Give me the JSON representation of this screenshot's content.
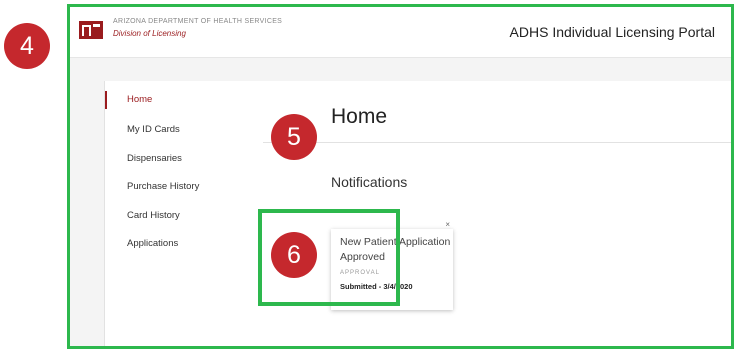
{
  "header": {
    "agency_name": "ARIZONA DEPARTMENT OF HEALTH SERVICES",
    "division": "Division of Licensing",
    "portal_title": "ADHS Individual Licensing Portal"
  },
  "sidebar": {
    "items": [
      {
        "label": "Home",
        "active": true
      },
      {
        "label": "My ID Cards"
      },
      {
        "label": "Dispensaries"
      },
      {
        "label": "Purchase History"
      },
      {
        "label": "Card History"
      },
      {
        "label": "Applications"
      }
    ]
  },
  "main": {
    "page_title": "Home",
    "notifications_heading": "Notifications",
    "notification": {
      "title": "New Patient Application Approved",
      "tag": "APPROVAL",
      "submitted": "Submitted - 3/4/2020",
      "close_glyph": "×"
    }
  },
  "callouts": {
    "badge_4": "4",
    "badge_5": "5",
    "badge_6": "6"
  },
  "colors": {
    "brand": "#9a1b1e",
    "highlight": "#2db84d",
    "badge": "#c5282d"
  },
  "icons": {
    "logo": "adhs-logo-icon",
    "close": "close-icon"
  }
}
